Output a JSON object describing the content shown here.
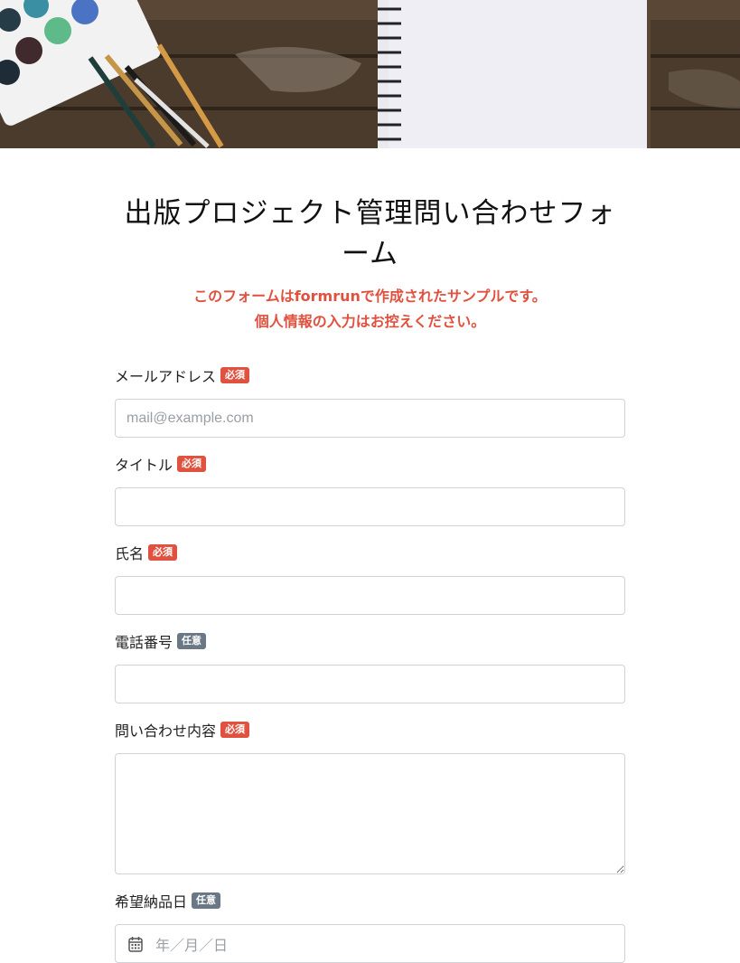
{
  "header": {
    "image_alt": ""
  },
  "form": {
    "title": "出版プロジェクト管理問い合わせフォーム",
    "notice_line1": "このフォームはformrunで作成されたサンプルです。",
    "notice_line2": "個人情報の入力はお控えください。",
    "required_badge": "必須",
    "optional_badge": "任意",
    "fields": {
      "email": {
        "label": "メールアドレス",
        "placeholder": "mail@example.com"
      },
      "title": {
        "label": "タイトル"
      },
      "name": {
        "label": "氏名"
      },
      "phone": {
        "label": "電話番号"
      },
      "inquiry": {
        "label": "問い合わせ内容"
      },
      "delivery_date": {
        "label": "希望納品日",
        "placeholder": "年／月／日"
      }
    }
  },
  "colors": {
    "accent_red": "#e0513f",
    "badge_gray": "#6a7886"
  }
}
